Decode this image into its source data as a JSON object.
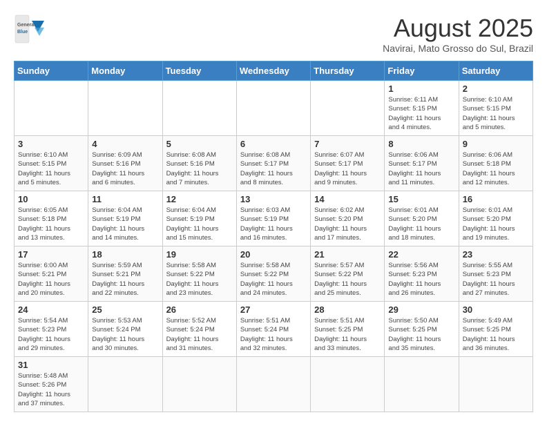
{
  "header": {
    "logo_general": "General",
    "logo_blue": "Blue",
    "title": "August 2025",
    "subtitle": "Navirai, Mato Grosso do Sul, Brazil"
  },
  "weekdays": [
    "Sunday",
    "Monday",
    "Tuesday",
    "Wednesday",
    "Thursday",
    "Friday",
    "Saturday"
  ],
  "weeks": [
    [
      {
        "day": "",
        "info": ""
      },
      {
        "day": "",
        "info": ""
      },
      {
        "day": "",
        "info": ""
      },
      {
        "day": "",
        "info": ""
      },
      {
        "day": "",
        "info": ""
      },
      {
        "day": "1",
        "info": "Sunrise: 6:11 AM\nSunset: 5:15 PM\nDaylight: 11 hours\nand 4 minutes."
      },
      {
        "day": "2",
        "info": "Sunrise: 6:10 AM\nSunset: 5:15 PM\nDaylight: 11 hours\nand 5 minutes."
      }
    ],
    [
      {
        "day": "3",
        "info": "Sunrise: 6:10 AM\nSunset: 5:15 PM\nDaylight: 11 hours\nand 5 minutes."
      },
      {
        "day": "4",
        "info": "Sunrise: 6:09 AM\nSunset: 5:16 PM\nDaylight: 11 hours\nand 6 minutes."
      },
      {
        "day": "5",
        "info": "Sunrise: 6:08 AM\nSunset: 5:16 PM\nDaylight: 11 hours\nand 7 minutes."
      },
      {
        "day": "6",
        "info": "Sunrise: 6:08 AM\nSunset: 5:17 PM\nDaylight: 11 hours\nand 8 minutes."
      },
      {
        "day": "7",
        "info": "Sunrise: 6:07 AM\nSunset: 5:17 PM\nDaylight: 11 hours\nand 9 minutes."
      },
      {
        "day": "8",
        "info": "Sunrise: 6:06 AM\nSunset: 5:17 PM\nDaylight: 11 hours\nand 11 minutes."
      },
      {
        "day": "9",
        "info": "Sunrise: 6:06 AM\nSunset: 5:18 PM\nDaylight: 11 hours\nand 12 minutes."
      }
    ],
    [
      {
        "day": "10",
        "info": "Sunrise: 6:05 AM\nSunset: 5:18 PM\nDaylight: 11 hours\nand 13 minutes."
      },
      {
        "day": "11",
        "info": "Sunrise: 6:04 AM\nSunset: 5:19 PM\nDaylight: 11 hours\nand 14 minutes."
      },
      {
        "day": "12",
        "info": "Sunrise: 6:04 AM\nSunset: 5:19 PM\nDaylight: 11 hours\nand 15 minutes."
      },
      {
        "day": "13",
        "info": "Sunrise: 6:03 AM\nSunset: 5:19 PM\nDaylight: 11 hours\nand 16 minutes."
      },
      {
        "day": "14",
        "info": "Sunrise: 6:02 AM\nSunset: 5:20 PM\nDaylight: 11 hours\nand 17 minutes."
      },
      {
        "day": "15",
        "info": "Sunrise: 6:01 AM\nSunset: 5:20 PM\nDaylight: 11 hours\nand 18 minutes."
      },
      {
        "day": "16",
        "info": "Sunrise: 6:01 AM\nSunset: 5:20 PM\nDaylight: 11 hours\nand 19 minutes."
      }
    ],
    [
      {
        "day": "17",
        "info": "Sunrise: 6:00 AM\nSunset: 5:21 PM\nDaylight: 11 hours\nand 20 minutes."
      },
      {
        "day": "18",
        "info": "Sunrise: 5:59 AM\nSunset: 5:21 PM\nDaylight: 11 hours\nand 22 minutes."
      },
      {
        "day": "19",
        "info": "Sunrise: 5:58 AM\nSunset: 5:22 PM\nDaylight: 11 hours\nand 23 minutes."
      },
      {
        "day": "20",
        "info": "Sunrise: 5:58 AM\nSunset: 5:22 PM\nDaylight: 11 hours\nand 24 minutes."
      },
      {
        "day": "21",
        "info": "Sunrise: 5:57 AM\nSunset: 5:22 PM\nDaylight: 11 hours\nand 25 minutes."
      },
      {
        "day": "22",
        "info": "Sunrise: 5:56 AM\nSunset: 5:23 PM\nDaylight: 11 hours\nand 26 minutes."
      },
      {
        "day": "23",
        "info": "Sunrise: 5:55 AM\nSunset: 5:23 PM\nDaylight: 11 hours\nand 27 minutes."
      }
    ],
    [
      {
        "day": "24",
        "info": "Sunrise: 5:54 AM\nSunset: 5:23 PM\nDaylight: 11 hours\nand 29 minutes."
      },
      {
        "day": "25",
        "info": "Sunrise: 5:53 AM\nSunset: 5:24 PM\nDaylight: 11 hours\nand 30 minutes."
      },
      {
        "day": "26",
        "info": "Sunrise: 5:52 AM\nSunset: 5:24 PM\nDaylight: 11 hours\nand 31 minutes."
      },
      {
        "day": "27",
        "info": "Sunrise: 5:51 AM\nSunset: 5:24 PM\nDaylight: 11 hours\nand 32 minutes."
      },
      {
        "day": "28",
        "info": "Sunrise: 5:51 AM\nSunset: 5:25 PM\nDaylight: 11 hours\nand 33 minutes."
      },
      {
        "day": "29",
        "info": "Sunrise: 5:50 AM\nSunset: 5:25 PM\nDaylight: 11 hours\nand 35 minutes."
      },
      {
        "day": "30",
        "info": "Sunrise: 5:49 AM\nSunset: 5:25 PM\nDaylight: 11 hours\nand 36 minutes."
      }
    ],
    [
      {
        "day": "31",
        "info": "Sunrise: 5:48 AM\nSunset: 5:26 PM\nDaylight: 11 hours\nand 37 minutes."
      },
      {
        "day": "",
        "info": ""
      },
      {
        "day": "",
        "info": ""
      },
      {
        "day": "",
        "info": ""
      },
      {
        "day": "",
        "info": ""
      },
      {
        "day": "",
        "info": ""
      },
      {
        "day": "",
        "info": ""
      }
    ]
  ]
}
